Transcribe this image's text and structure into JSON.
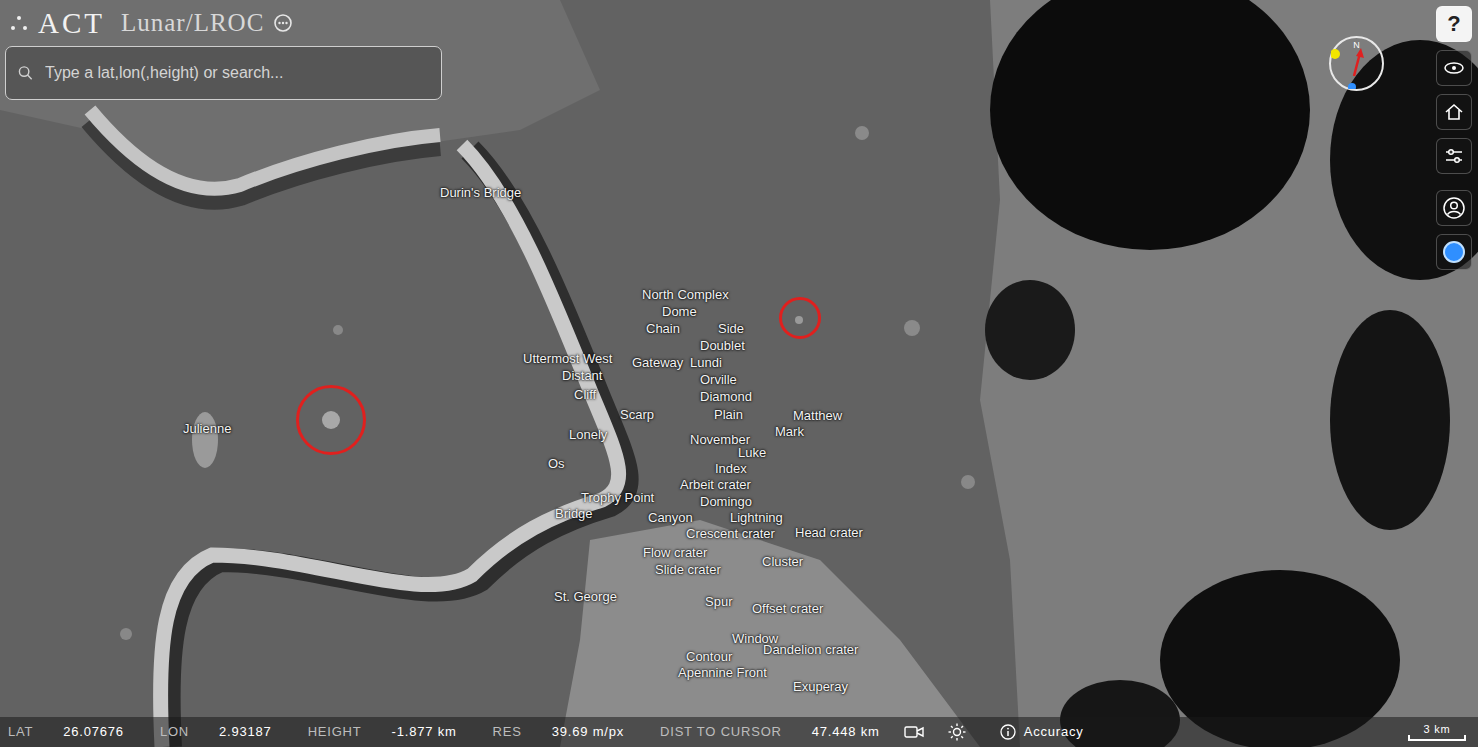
{
  "app": {
    "mark": "ACT",
    "product": "Lunar/LROC"
  },
  "search": {
    "placeholder": "Type a lat,lon(,height) or search..."
  },
  "help_button": "?",
  "compass": {
    "label": "N"
  },
  "markers": [
    {
      "color": "#e0201e"
    },
    {
      "color": "#e0201e"
    }
  ],
  "labels": [
    "Durin's Bridge",
    "Julienne",
    "Uttermost West",
    "Distant",
    "Cliff",
    "Lonely",
    "Os",
    "Trophy Point",
    "Bridge",
    "St. George",
    "North Complex",
    "Dome",
    "Chain",
    "Side",
    "Doublet",
    "Gateway",
    "Lundi",
    "Orville",
    "Diamond",
    "Scarp",
    "Plain",
    "Matthew",
    "Mark",
    "November",
    "Luke",
    "Index",
    "Arbeit crater",
    "Domingo",
    "Canyon",
    "Lightning",
    "Crescent crater",
    "Head crater",
    "Flow crater",
    "Cluster",
    "Slide crater",
    "Spur",
    "Offset crater",
    "Window",
    "Dandelion crater",
    "Contour",
    "Apennine Front",
    "Exuperay"
  ],
  "status_bar": {
    "fields": [
      {
        "label": "LAT",
        "value": "26.07676"
      },
      {
        "label": "LON",
        "value": "2.93187"
      },
      {
        "label": "HEIGHT",
        "value": "-1.877 km"
      },
      {
        "label": "RES",
        "value": "39.69 m/px"
      },
      {
        "label": "DIST TO CURSOR",
        "value": "47.448 km"
      }
    ],
    "accuracy": "Accuracy",
    "scale": "3 km"
  }
}
